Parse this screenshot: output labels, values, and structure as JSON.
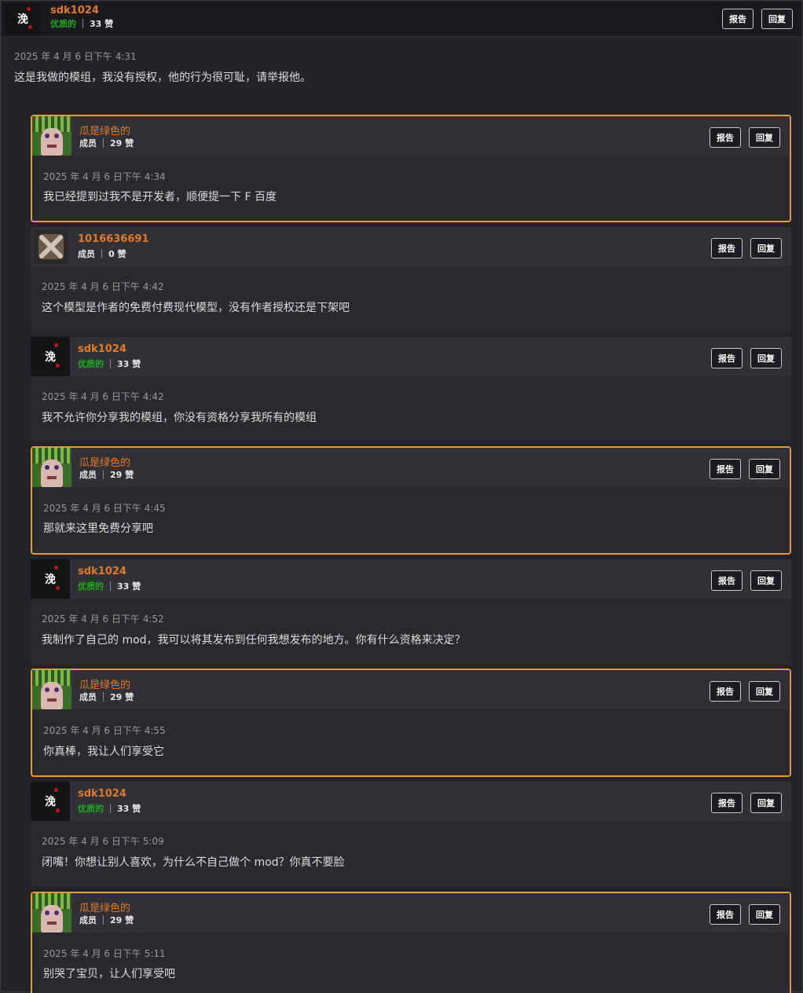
{
  "buttons": {
    "report": "报告",
    "reply": "回复"
  },
  "top": {
    "username": "sdk1024",
    "role": "优质的",
    "likes": "33 赞",
    "date": "2025 年 4 月 6 日下午 4:31",
    "text": "这是我做的模组，我没有授权，他的行为很可耻，请举报他。"
  },
  "replies": [
    {
      "username": "瓜是绿色的",
      "role": "成员",
      "likes": "29 赞",
      "date": "2025 年 4 月 6 日下午 4:34",
      "text": "我已经提到过我不是开发者，顺便提一下 F 百度"
    },
    {
      "username": "1016636691",
      "role": "成员",
      "likes": "0 赞",
      "date": "2025 年 4 月 6 日下午 4:42",
      "text": "这个模型是作者的免费付费现代模型，没有作者授权还是下架吧"
    },
    {
      "username": "sdk1024",
      "role": "优质的",
      "likes": "33 赞",
      "date": "2025 年 4 月 6 日下午 4:42",
      "text": "我不允许你分享我的模组，你没有资格分享我所有的模组"
    },
    {
      "username": "瓜是绿色的",
      "role": "成员",
      "likes": "29 赞",
      "date": "2025 年 4 月 6 日下午 4:45",
      "text": "那就来这里免费分享吧"
    },
    {
      "username": "sdk1024",
      "role": "优质的",
      "likes": "33 赞",
      "date": "2025 年 4 月 6 日下午 4:52",
      "text": "我制作了自己的 mod，我可以将其发布到任何我想发布的地方。你有什么资格来决定？"
    },
    {
      "username": "瓜是绿色的",
      "role": "成员",
      "likes": "29 赞",
      "date": "2025 年 4 月 6 日下午 4:55",
      "text": "你真棒，我让人们享受它"
    },
    {
      "username": "sdk1024",
      "role": "优质的",
      "likes": "33 赞",
      "date": "2025 年 4 月 6 日下午 5:09",
      "text": "闭嘴！你想让别人喜欢，为什么不自己做个 mod？你真不要脸"
    },
    {
      "username": "瓜是绿色的",
      "role": "成员",
      "likes": "29 赞",
      "date": "2025 年 4 月 6 日下午 5:11",
      "text": "别哭了宝贝，让人们享受吧"
    }
  ],
  "colors": {
    "accent_orange": "#e79a3b",
    "username_orange": "#e07b2e",
    "role_green": "#1faa1f",
    "background": "#232328",
    "card": "#2a2a2e"
  },
  "icons": {
    "sdk_avatar": "calligraphy-logo-avatar",
    "melon_avatar": "watermelon-character-avatar",
    "cross_avatar": "x-crossed-square-avatar"
  }
}
